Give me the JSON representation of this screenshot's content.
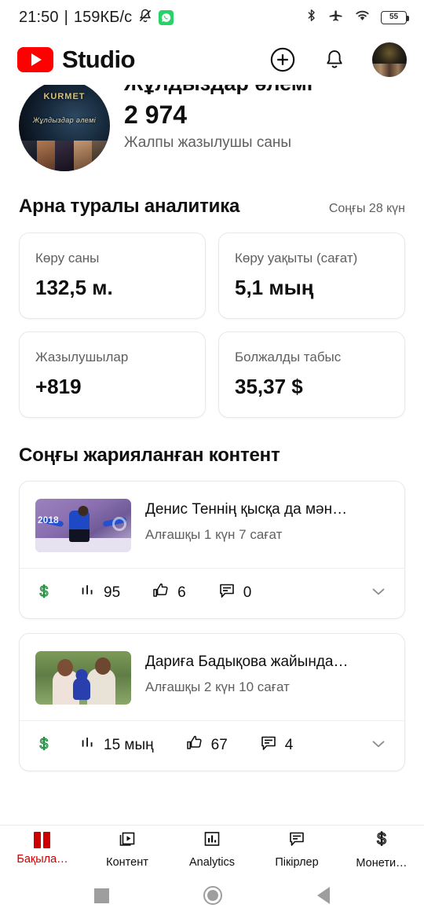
{
  "status_bar": {
    "clock": "21:50",
    "separator": "|",
    "network_speed": "159КБ/с",
    "icons": [
      "mute-bell-icon",
      "whatsapp-icon",
      "bluetooth-icon",
      "airplane-mode-icon",
      "wifi-icon",
      "battery-icon"
    ],
    "battery_percent": "55"
  },
  "app_bar": {
    "brand": "Studio",
    "logo": "youtube-logo",
    "actions": [
      "create-icon",
      "notifications-icon",
      "account-avatar"
    ]
  },
  "channel": {
    "name": "Жұлдыздар әлемі",
    "subscriber_count": "2 974",
    "subscriber_label": "Жалпы жазылушы саны",
    "avatar_top_text": "KURMET",
    "avatar_sub_text": "Жұлдыздар әлемі"
  },
  "analytics": {
    "title": "Арна туралы аналитика",
    "period": "Соңғы 28 күн",
    "cards": [
      {
        "label": "Көру саны",
        "value": "132,5 м."
      },
      {
        "label": "Көру уақыты (сағат)",
        "value": "5,1 мың"
      },
      {
        "label": "Жазылушылар",
        "value": "+819"
      },
      {
        "label": "Болжалды табыс",
        "value": "35,37 $"
      }
    ]
  },
  "recent": {
    "title": "Соңғы жарияланған контент",
    "videos": [
      {
        "title": "Денис Теннің қысқа да мән…",
        "subtitle": "Алғашқы 1 күн 7 сағат",
        "views": "95",
        "likes": "6",
        "comments": "0",
        "monetization": "monetization-on",
        "thumbnail_year": "2018"
      },
      {
        "title": "Дариға Бадықова жайында…",
        "subtitle": "Алғашқы 2 күн 10 сағат",
        "views": "15 мың",
        "likes": "67",
        "comments": "4",
        "monetization": "monetization-on",
        "thumbnail_year": ""
      }
    ]
  },
  "bottom_nav": {
    "items": [
      {
        "label": "Бақыла…",
        "icon": "dashboard-icon",
        "active": true
      },
      {
        "label": "Контент",
        "icon": "video-library-icon",
        "active": false
      },
      {
        "label": "Analytics",
        "icon": "bar-chart-icon",
        "active": false
      },
      {
        "label": "Пікірлер",
        "icon": "comment-icon",
        "active": false
      },
      {
        "label": "Монети…",
        "icon": "dollar-icon",
        "active": false
      }
    ]
  },
  "android_nav": {
    "buttons": [
      "recents-button",
      "home-button",
      "back-button"
    ]
  },
  "colors": {
    "brand_red": "#FF0000",
    "active_red": "#CC0000",
    "money_green": "#1E8E3E",
    "text_primary": "#0F0F0F",
    "text_secondary": "#606060"
  }
}
